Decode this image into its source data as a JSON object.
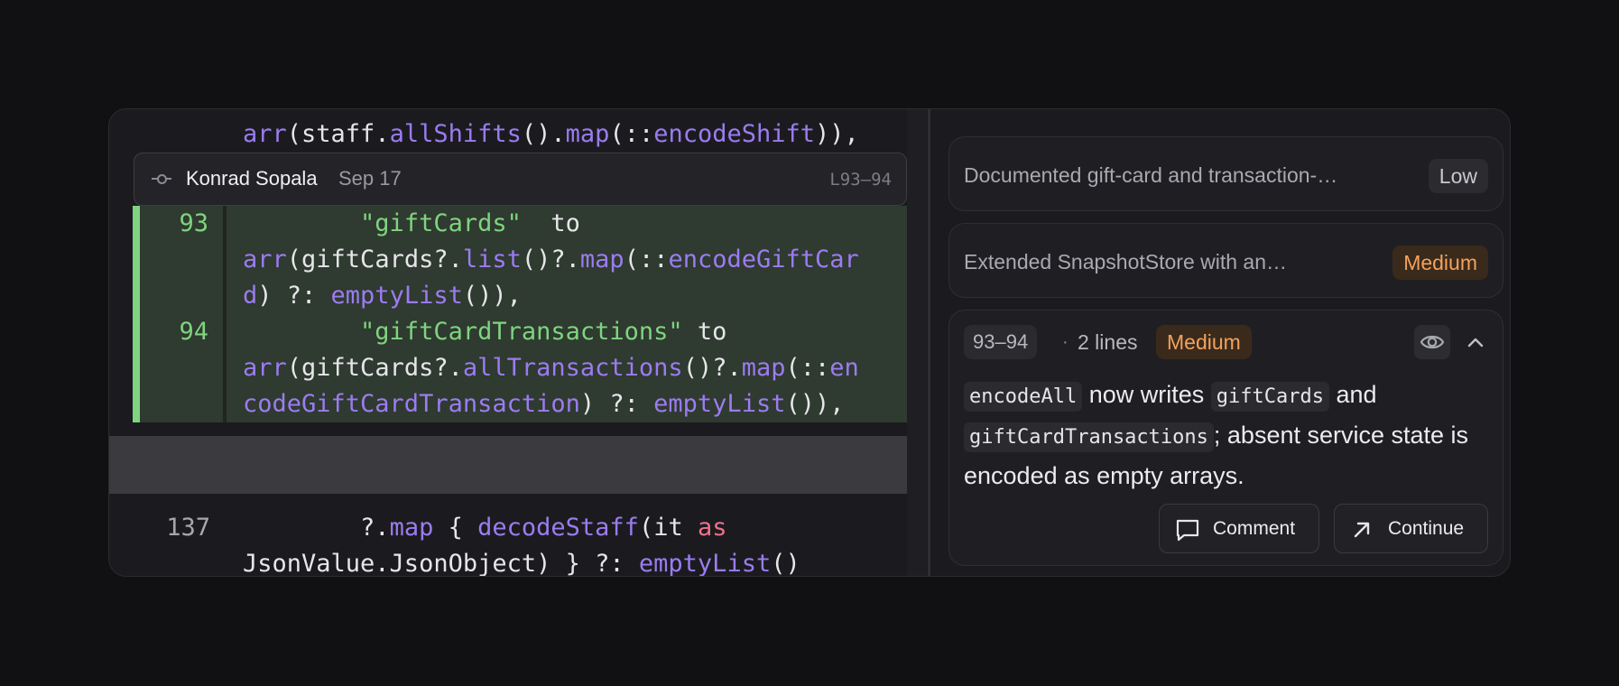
{
  "code": {
    "top_line": [
      {
        "t": "arr",
        "c": "fn"
      },
      {
        "t": "(staff.",
        "c": "plain"
      },
      {
        "t": "allShifts",
        "c": "fn"
      },
      {
        "t": "().",
        "c": "plain"
      },
      {
        "t": "map",
        "c": "fn"
      },
      {
        "t": "(::",
        "c": "plain"
      },
      {
        "t": "encodeShift",
        "c": "fn"
      },
      {
        "t": ")),",
        "c": "plain"
      }
    ],
    "blame": {
      "author": "Konrad Sopala",
      "date": "Sep 17",
      "range": "L93–94"
    },
    "diff_lines": [
      {
        "number": "93",
        "rows": [
          [
            {
              "t": "        ",
              "c": "plain"
            },
            {
              "t": "\"giftCards\"",
              "c": "str"
            },
            {
              "t": "  to",
              "c": "plain"
            }
          ],
          [
            {
              "t": "arr",
              "c": "fn"
            },
            {
              "t": "(giftCards?.",
              "c": "plain"
            },
            {
              "t": "list",
              "c": "fn"
            },
            {
              "t": "()?.",
              "c": "plain"
            },
            {
              "t": "map",
              "c": "fn"
            },
            {
              "t": "(::",
              "c": "plain"
            },
            {
              "t": "encodeGiftCar",
              "c": "fn"
            }
          ],
          [
            {
              "t": "d",
              "c": "fn"
            },
            {
              "t": ") ?: ",
              "c": "plain"
            },
            {
              "t": "emptyList",
              "c": "fn"
            },
            {
              "t": "()),",
              "c": "plain"
            }
          ]
        ]
      },
      {
        "number": "94",
        "rows": [
          [
            {
              "t": "        ",
              "c": "plain"
            },
            {
              "t": "\"giftCardTransactions\"",
              "c": "str"
            },
            {
              "t": " to",
              "c": "plain"
            }
          ],
          [
            {
              "t": "arr",
              "c": "fn"
            },
            {
              "t": "(giftCards?.",
              "c": "plain"
            },
            {
              "t": "allTransactions",
              "c": "fn"
            },
            {
              "t": "()?.",
              "c": "plain"
            },
            {
              "t": "map",
              "c": "fn"
            },
            {
              "t": "(::",
              "c": "plain"
            },
            {
              "t": "en",
              "c": "fn"
            }
          ],
          [
            {
              "t": "codeGiftCardTransaction",
              "c": "fn"
            },
            {
              "t": ") ?: ",
              "c": "plain"
            },
            {
              "t": "emptyList",
              "c": "fn"
            },
            {
              "t": "()),",
              "c": "plain"
            }
          ]
        ]
      }
    ],
    "context_line": {
      "number": "137",
      "rows": [
        [
          {
            "t": "        ?.",
            "c": "plain"
          },
          {
            "t": "map",
            "c": "fn"
          },
          {
            "t": " { ",
            "c": "plain"
          },
          {
            "t": "decodeStaff",
            "c": "fn"
          },
          {
            "t": "(it ",
            "c": "plain"
          },
          {
            "t": "as",
            "c": "kw"
          }
        ],
        [
          {
            "t": "JsonValue.JsonObject) } ?: ",
            "c": "plain"
          },
          {
            "t": "emptyList",
            "c": "fn"
          },
          {
            "t": "()",
            "c": "plain"
          }
        ]
      ]
    }
  },
  "findings": [
    {
      "summary": "Documented gift-card and transaction-…",
      "severity": "Low"
    },
    {
      "summary": "Extended SnapshotStore with an…",
      "severity": "Medium"
    }
  ],
  "detail": {
    "range": "93–94",
    "separator": "·",
    "lines": "2 lines",
    "severity": "Medium",
    "body": {
      "code1": "encodeAll",
      "text1": " now writes ",
      "code2": "giftCards",
      "text2": " and ",
      "code3": "giftCardTransactions",
      "text3": "; absent service state is encoded as empty arrays."
    },
    "comment_label": "Comment",
    "continue_label": "Continue"
  },
  "colors": {
    "accent_added": "#7fd47f",
    "function": "#9b7cf0",
    "keyword": "#f0708c",
    "medium": "#f2a25c"
  }
}
